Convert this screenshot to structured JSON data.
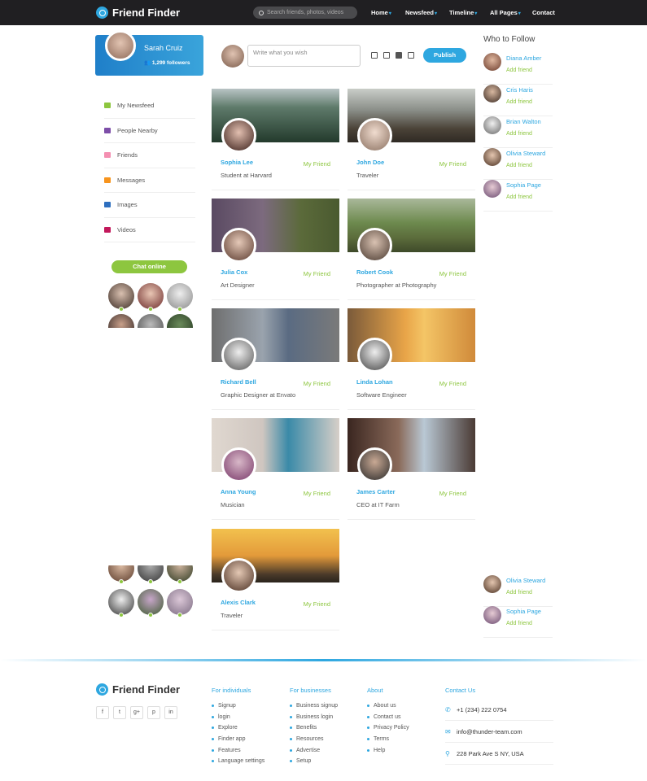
{
  "brand": {
    "name": "Friend Finder"
  },
  "header": {
    "search_placeholder": "Search friends, photos, videos",
    "nav": [
      "Home",
      "Newsfeed",
      "Timeline",
      "All Pages",
      "Contact"
    ]
  },
  "profile": {
    "name": "Sarah Cruiz",
    "followers": "1,299 followers"
  },
  "sidebar": {
    "items": [
      {
        "label": "My Newsfeed",
        "color": "#8dc63f"
      },
      {
        "label": "People Nearby",
        "color": "#7d4ea8"
      },
      {
        "label": "Friends",
        "color": "#f48fb1"
      },
      {
        "label": "Messages",
        "color": "#f7941d"
      },
      {
        "label": "Images",
        "color": "#2e6fbf"
      },
      {
        "label": "Videos",
        "color": "#c2185b"
      }
    ],
    "chat_label": "Chat online"
  },
  "composer": {
    "placeholder": "Write what you wish",
    "publish_label": "Publish"
  },
  "friends": [
    {
      "name": "Sophia Lee",
      "job": "Student at Harvard",
      "badge": "My Friend"
    },
    {
      "name": "John Doe",
      "job": "Traveler",
      "badge": "My Friend"
    },
    {
      "name": "Julia Cox",
      "job": "Art Designer",
      "badge": "My Friend"
    },
    {
      "name": "Robert Cook",
      "job": "Photographer at Photography",
      "badge": "My Friend"
    },
    {
      "name": "Richard Bell",
      "job": "Graphic Designer at Envato",
      "badge": "My Friend"
    },
    {
      "name": "Linda Lohan",
      "job": "Software Engineer",
      "badge": "My Friend"
    },
    {
      "name": "Anna Young",
      "job": "Musician",
      "badge": "My Friend"
    },
    {
      "name": "James Carter",
      "job": "CEO at IT Farm",
      "badge": "My Friend"
    },
    {
      "name": "Alexis Clark",
      "job": "Traveler",
      "badge": "My Friend"
    }
  ],
  "who_to_follow": {
    "title": "Who to Follow",
    "add_label": "Add friend",
    "people": [
      "Diana Amber",
      "Cris Haris",
      "Brian Walton",
      "Olivia Steward",
      "Sophia Page"
    ],
    "people_bottom": [
      "Olivia Steward",
      "Sophia Page"
    ]
  },
  "footer": {
    "columns": [
      {
        "title": "For individuals",
        "links": [
          "Signup",
          "login",
          "Explore",
          "Finder app",
          "Features",
          "Language settings"
        ]
      },
      {
        "title": "For businesses",
        "links": [
          "Business signup",
          "Business login",
          "Benefits",
          "Resources",
          "Advertise",
          "Setup"
        ]
      },
      {
        "title": "About",
        "links": [
          "About us",
          "Contact us",
          "Privacy Policy",
          "Terms",
          "Help"
        ]
      }
    ],
    "contact": {
      "title": "Contact Us",
      "phone": "+1 (234) 222 0754",
      "email": "info@thunder-team.com",
      "address": "228 Park Ave S NY, USA"
    },
    "social": [
      "f",
      "t",
      "g+",
      "p",
      "in"
    ]
  },
  "colors": {
    "accent": "#2ea7e0",
    "green": "#8dc63f",
    "topbar": "#201f22"
  }
}
